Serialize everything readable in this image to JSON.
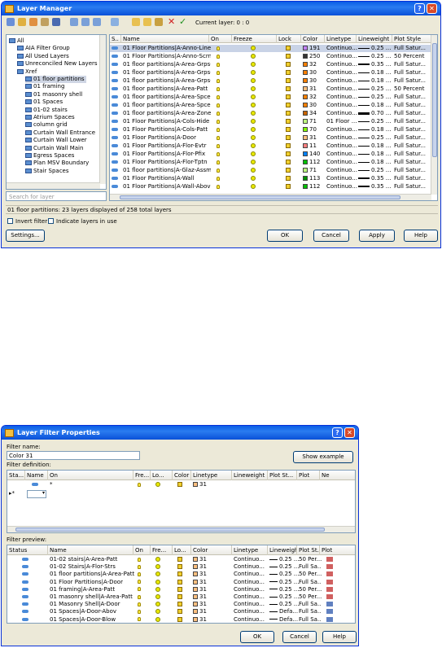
{
  "lm": {
    "title": "Layer Manager",
    "help_glyph": "?",
    "close_glyph": "✕",
    "current_layer": "Current layer: 0 : 0",
    "tree": [
      {
        "label": "All",
        "indent": 0,
        "sel": false
      },
      {
        "label": "AIA Filter Group",
        "indent": 1,
        "sel": false
      },
      {
        "label": "All Used Layers",
        "indent": 1,
        "sel": false
      },
      {
        "label": "Unreconciled New Layers",
        "indent": 1,
        "sel": false
      },
      {
        "label": "Xref",
        "indent": 1,
        "sel": false
      },
      {
        "label": "01 floor partitions",
        "indent": 2,
        "sel": true
      },
      {
        "label": "01 framing",
        "indent": 2,
        "sel": false
      },
      {
        "label": "01 masonry shell",
        "indent": 2,
        "sel": false
      },
      {
        "label": "01 Spaces",
        "indent": 2,
        "sel": false
      },
      {
        "label": "01-02 stairs",
        "indent": 2,
        "sel": false
      },
      {
        "label": "Atrium Spaces",
        "indent": 2,
        "sel": false
      },
      {
        "label": "column grid",
        "indent": 2,
        "sel": false
      },
      {
        "label": "Curtain Wall Entrance",
        "indent": 2,
        "sel": false
      },
      {
        "label": "Curtain Wall Lower",
        "indent": 2,
        "sel": false
      },
      {
        "label": "Curtain Wall Main",
        "indent": 2,
        "sel": false
      },
      {
        "label": "Egress Spaces",
        "indent": 2,
        "sel": false
      },
      {
        "label": "Plan MSV Boundary",
        "indent": 2,
        "sel": false
      },
      {
        "label": "Stair Spaces",
        "indent": 2,
        "sel": false
      }
    ],
    "search_placeholder": "Search for layer",
    "columns": [
      "S..",
      "Name",
      "On",
      "Freeze",
      "Lock",
      "Color",
      "Linetype",
      "Lineweight",
      "Plot Style"
    ],
    "layers": [
      {
        "name": "01 Floor Partitions|A-Anno-Line",
        "color_num": "191",
        "color_hex": "#c080ff",
        "lt": "Continuo...",
        "lw": "0.25 ...",
        "ps": "Full Satur...",
        "sel": true
      },
      {
        "name": "01 Floor Partitions|A-Anno-Scrn",
        "color_num": "250",
        "color_hex": "#333333",
        "lt": "Continuo...",
        "lw": "0.25 ...",
        "ps": "50 Percent",
        "sel": false
      },
      {
        "name": "01 floor partitions|A-Area-Grps-Iden",
        "color_num": "32",
        "color_hex": "#ff8000",
        "lt": "Continuo...",
        "lw": "0.35 ...",
        "ps": "Full Satur...",
        "sel": false
      },
      {
        "name": "01 floor partitions|A-Area-Grps-Line",
        "color_num": "30",
        "color_hex": "#ff7f00",
        "lt": "Continuo...",
        "lw": "0.18 ...",
        "ps": "Full Satur...",
        "sel": false
      },
      {
        "name": "01 floor partitions|A-Area-Grps-Patt",
        "color_num": "30",
        "color_hex": "#ff7f00",
        "lt": "Continuo...",
        "lw": "0.18 ...",
        "ps": "Full Satur...",
        "sel": false
      },
      {
        "name": "01 floor partitions|A-Area-Patt",
        "color_num": "31",
        "color_hex": "#ffbf7f",
        "lt": "Continuo...",
        "lw": "0.25 ...",
        "ps": "50 Percent",
        "sel": false
      },
      {
        "name": "01 floor partitions|A-Area-Spce",
        "color_num": "32",
        "color_hex": "#ff8000",
        "lt": "Continuo...",
        "lw": "0.25 ...",
        "ps": "Full Satur...",
        "sel": false
      },
      {
        "name": "01 floor partitions|A-Area-Spce-Patt",
        "color_num": "30",
        "color_hex": "#ff7f00",
        "lt": "Continuo...",
        "lw": "0.18 ...",
        "ps": "Full Satur...",
        "sel": false
      },
      {
        "name": "01 floor partitions|A-Area-Zone",
        "color_num": "34",
        "color_hex": "#c86400",
        "lt": "Continuo...",
        "lw": "0.70 ...",
        "ps": "Full Satur...",
        "sel": false
      },
      {
        "name": "01 Floor Partitions|A-Cols-Hide",
        "color_num": "71",
        "color_hex": "#bfff7f",
        "lt": "01 Floor ...",
        "lw": "0.25 ...",
        "ps": "Full Satur...",
        "sel": false
      },
      {
        "name": "01 Floor Partitions|A-Cols-Patt",
        "color_num": "70",
        "color_hex": "#80ff00",
        "lt": "Continuo...",
        "lw": "0.18 ...",
        "ps": "Full Satur...",
        "sel": false
      },
      {
        "name": "01 Floor Partitions|A-Door",
        "color_num": "31",
        "color_hex": "#ffbf7f",
        "lt": "Continuo...",
        "lw": "0.25 ...",
        "ps": "Full Satur...",
        "sel": false
      },
      {
        "name": "01 Floor Partitions|A-Flor-Evtr",
        "color_num": "11",
        "color_hex": "#ff7f7f",
        "lt": "Continuo...",
        "lw": "0.18 ...",
        "ps": "Full Satur...",
        "sel": false
      },
      {
        "name": "01 Floor Partitions|A-Flor-Pfix",
        "color_num": "140",
        "color_hex": "#0080ff",
        "lt": "Continuo...",
        "lw": "0.18 ...",
        "ps": "Full Satur...",
        "sel": false
      },
      {
        "name": "01 Floor Partitions|A-Flor-Tptn",
        "color_num": "112",
        "color_hex": "#00c000",
        "lt": "Continuo...",
        "lw": "0.18 ...",
        "ps": "Full Satur...",
        "sel": false
      },
      {
        "name": "01 floor partitions|A-Glaz-Assm",
        "color_num": "71",
        "color_hex": "#bfff7f",
        "lt": "Continuo...",
        "lw": "0.25 ...",
        "ps": "Full Satur...",
        "sel": false
      },
      {
        "name": "01 Floor Partitions|A-Wall",
        "color_num": "113",
        "color_hex": "#009000",
        "lt": "Continuo...",
        "lw": "0.35 ...",
        "ps": "Full Satur...",
        "sel": false
      },
      {
        "name": "01 Floor Partitions|A-Wall-Abov",
        "color_num": "112",
        "color_hex": "#00c000",
        "lt": "Continuo...",
        "lw": "0.35 ...",
        "ps": "Full Satur...",
        "sel": false
      }
    ],
    "status_text": "01 floor partitions: 23 layers displayed of 258 total layers",
    "invert_filter": "Invert filter",
    "indicate_layers": "Indicate layers in use",
    "settings": "Settings...",
    "ok": "OK",
    "cancel": "Cancel",
    "apply": "Apply",
    "help": "Help"
  },
  "lfp": {
    "title": "Layer Filter Properties",
    "help_glyph": "?",
    "close_glyph": "✕",
    "filter_name_label": "Filter name:",
    "filter_name_value": "Color 31",
    "show_example": "Show example",
    "filter_def_label": "Filter definition:",
    "def_columns": [
      "Sta...",
      "Name",
      "On",
      "Fre...",
      "Lo...",
      "Color",
      "Linetype",
      "Lineweight",
      "Plot St...",
      "Plot",
      "Ne"
    ],
    "def_row1": {
      "name": "*",
      "color": "31"
    },
    "def_row2_marker": "▸*",
    "filter_preview_label": "Filter preview:",
    "prev_columns": [
      "Status",
      "Name",
      "On",
      "Fre...",
      "Lo...",
      "Color",
      "Linetype",
      "Lineweight",
      "Plot St...",
      "Plot"
    ],
    "preview": [
      {
        "name": "01-02 stairs|A-Area-Patt",
        "lt": "Continuo...",
        "lw": "0.25 ...",
        "ps": "50 Per..."
      },
      {
        "name": "01-02 Stairs|A-Flor-Strs",
        "lt": "Continuo...",
        "lw": "0.25 ...",
        "ps": "Full Sa..."
      },
      {
        "name": "01 floor partitions|A-Area-Patt",
        "lt": "Continuo...",
        "lw": "0.25 ...",
        "ps": "50 Per..."
      },
      {
        "name": "01 Floor Partitions|A-Door",
        "lt": "Continuo...",
        "lw": "0.25 ...",
        "ps": "Full Sa..."
      },
      {
        "name": "01 framing|A-Area-Patt",
        "lt": "Continuo...",
        "lw": "0.25 ...",
        "ps": "50 Per..."
      },
      {
        "name": "01 masonry shell|A-Area-Patt",
        "lt": "Continuo...",
        "lw": "0.25 ...",
        "ps": "50 Per..."
      },
      {
        "name": "01 Masonry Shell|A-Door",
        "lt": "Continuo...",
        "lw": "0.25 ...",
        "ps": "Full Sa..."
      },
      {
        "name": "01 Spaces|A-Door-Abov",
        "lt": "Continuo...",
        "lw": "Defa...",
        "ps": "Full Sa..."
      },
      {
        "name": "01 Spaces|A-Door-Blow",
        "lt": "Continuo...",
        "lw": "Defa...",
        "ps": "Full Sa..."
      }
    ],
    "preview_color": "31",
    "ok": "OK",
    "cancel": "Cancel",
    "help": "Help"
  }
}
